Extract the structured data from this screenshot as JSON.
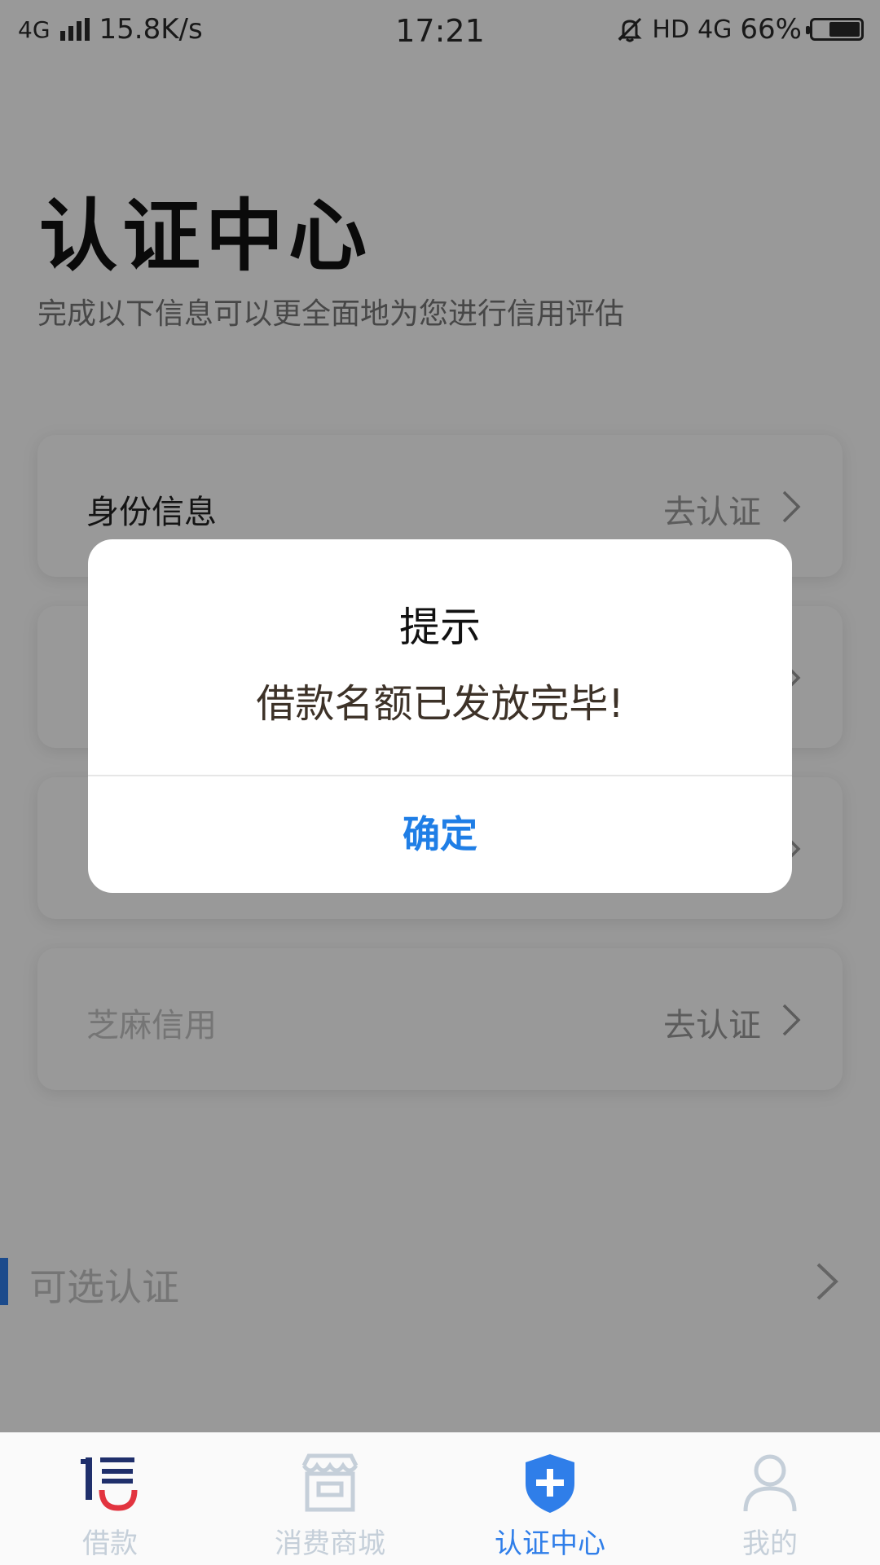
{
  "status_bar": {
    "network": "4G",
    "speed": "15.8K/s",
    "time": "17:21",
    "hd": "HD",
    "network_right": "4G",
    "battery": "66%",
    "battery_level": 0.66
  },
  "header": {
    "title": "认证中心",
    "subtitle": "完成以下信息可以更全面地为您进行信用评估"
  },
  "cards": [
    {
      "label": "身份信息",
      "action": "去认证"
    },
    {
      "label": "",
      "action": ""
    },
    {
      "label": "",
      "action": ""
    },
    {
      "label": "芝麻信用",
      "action": "去认证"
    }
  ],
  "optional": {
    "label": "可选认证"
  },
  "tabbar": {
    "items": [
      {
        "label": "借款",
        "icon": "brand-xin-icon"
      },
      {
        "label": "消费商城",
        "icon": "store-icon"
      },
      {
        "label": "认证中心",
        "icon": "shield-plus-icon",
        "active": true
      },
      {
        "label": "我的",
        "icon": "person-icon"
      }
    ]
  },
  "dialog": {
    "title": "提示",
    "message": "借款名额已发放完毕!",
    "confirm": "确定"
  },
  "colors": {
    "accent": "#2f7ee9",
    "dialog_button": "#1f7ee6",
    "brand_red": "#e2343f",
    "brand_navy": "#1f2f6b"
  }
}
